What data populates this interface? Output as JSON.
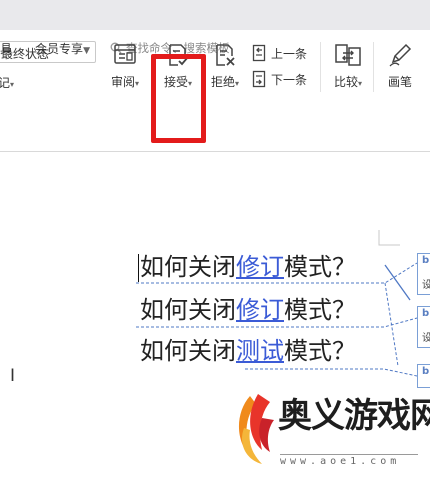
{
  "menu_tabs": [
    "具",
    "会员专享"
  ],
  "search": {
    "placeholder": "查找命令、搜索模板"
  },
  "display_mode": {
    "value": "最终状态"
  },
  "show_markup": {
    "label": "记"
  },
  "tools": {
    "review": "审阅",
    "accept": "接受",
    "reject": "拒绝",
    "prev": "上一条",
    "next": "下一条",
    "compare": "比较",
    "pen": "画笔"
  },
  "document": {
    "lines": [
      {
        "before": "如何关闭",
        "revision": "修订",
        "after": "模式？"
      },
      {
        "before": "如何关闭",
        "revision": "修订",
        "after": "模式？"
      },
      {
        "before": "如何关闭",
        "revision": "测试",
        "after": "模式？"
      }
    ]
  },
  "comments": [
    {
      "author_initial": "b",
      "text": "设"
    },
    {
      "author_initial": "b",
      "text": "设"
    },
    {
      "author_initial": "b",
      "text": ""
    }
  ],
  "watermark": {
    "name": "奥义游戏网",
    "url": "www.aoe1.com"
  },
  "colors": {
    "highlight_red": "#e31b1b",
    "revision_blue": "#3b5bd6",
    "comment_border": "#7a9fd6"
  },
  "icons": {
    "search": "search-icon",
    "review": "review-panel-icon",
    "accept": "accept-change-icon",
    "reject": "reject-change-icon",
    "prev": "previous-change-icon",
    "next": "next-change-icon",
    "compare": "compare-documents-icon",
    "pen": "pen-icon"
  }
}
